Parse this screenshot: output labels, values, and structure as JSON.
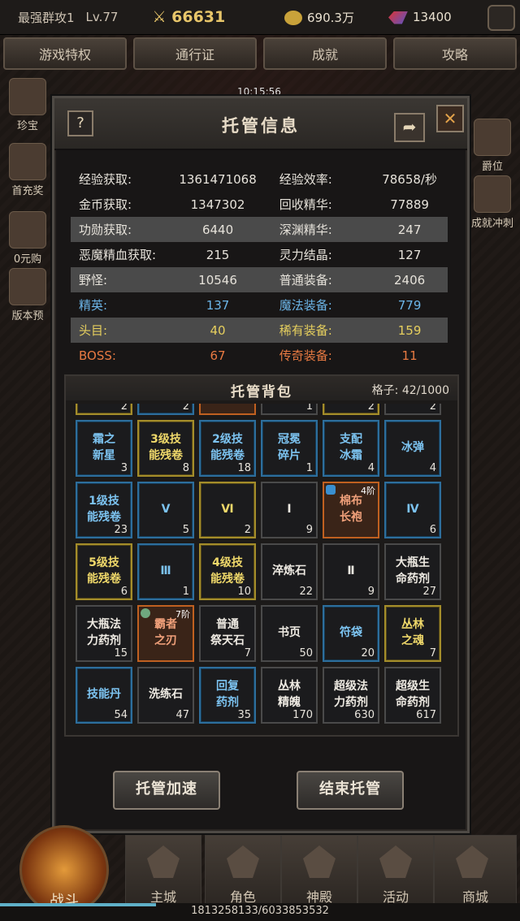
{
  "topbar": {
    "player_name": "最强群攻1",
    "level": "Lv.77",
    "combat_power": "66631",
    "gold": "690.3万",
    "gems": "13400"
  },
  "nav": [
    "游戏特权",
    "通行证",
    "成就",
    "攻略"
  ],
  "clock": "10:15:56",
  "dialog": {
    "title": "托管信息",
    "help_label": "?",
    "close_label": "✕",
    "share_label": "➦",
    "stats": [
      {
        "k1": "经验获取:",
        "v1": "1361471068",
        "k2": "经验效率:",
        "v2": "78658/秒",
        "color": "w",
        "hl": false
      },
      {
        "k1": "金币获取:",
        "v1": "1347302",
        "k2": "回收精华:",
        "v2": "77889",
        "color": "w",
        "hl": false
      },
      {
        "k1": "功勋获取:",
        "v1": "6440",
        "k2": "深渊精华:",
        "v2": "247",
        "color": "w",
        "hl": true
      },
      {
        "k1": "恶魔精血获取:",
        "v1": "215",
        "k2": "灵力结晶:",
        "v2": "127",
        "color": "w",
        "hl": false
      },
      {
        "k1": "野怪:",
        "v1": "10546",
        "k2": "普通装备:",
        "v2": "2406",
        "color": "w",
        "hl": true
      },
      {
        "k1": "精英:",
        "v1": "137",
        "k2": "魔法装备:",
        "v2": "779",
        "color": "b",
        "hl": false
      },
      {
        "k1": "头目:",
        "v1": "40",
        "k2": "稀有装备:",
        "v2": "159",
        "color": "y",
        "hl": true
      },
      {
        "k1": "BOSS:",
        "v1": "67",
        "k2": "传奇装备:",
        "v2": "11",
        "color": "o",
        "hl": false
      }
    ],
    "bag": {
      "title": "托管背包",
      "capacity": "格子: 42/1000",
      "partial_row": [
        {
          "name": "",
          "count": "2",
          "q": "yellow"
        },
        {
          "name": "",
          "count": "2",
          "q": "blue"
        },
        {
          "name": "",
          "count": "",
          "q": "orange"
        },
        {
          "name": "",
          "count": "1",
          "q": "white"
        },
        {
          "name": "",
          "count": "2",
          "q": "yellow"
        },
        {
          "name": "",
          "count": "2",
          "q": "white"
        }
      ],
      "items": [
        {
          "name": "霜之\n新星",
          "count": "3",
          "q": "blue",
          "nc": "b"
        },
        {
          "name": "3级技\n能残卷",
          "count": "8",
          "q": "yellow",
          "nc": "y"
        },
        {
          "name": "2级技\n能残卷",
          "count": "18",
          "q": "blue",
          "nc": "b"
        },
        {
          "name": "冠冕\n碎片",
          "count": "1",
          "q": "blue",
          "nc": "b"
        },
        {
          "name": "支配\n冰霜",
          "count": "4",
          "q": "blue",
          "nc": "b"
        },
        {
          "name": "冰弹",
          "count": "4",
          "q": "blue",
          "nc": "b"
        },
        {
          "name": "1级技\n能残卷",
          "count": "23",
          "q": "blue",
          "nc": "b"
        },
        {
          "name": "Ⅴ",
          "count": "5",
          "q": "blue",
          "nc": "b"
        },
        {
          "name": "Ⅵ",
          "count": "2",
          "q": "yellow",
          "nc": "y"
        },
        {
          "name": "Ⅰ",
          "count": "9",
          "q": "white",
          "nc": "w"
        },
        {
          "name": "棉布\n长袍",
          "count": "",
          "q": "orange",
          "nc": "o",
          "tier": "4阶",
          "tag": "b"
        },
        {
          "name": "Ⅳ",
          "count": "6",
          "q": "blue",
          "nc": "b"
        },
        {
          "name": "5级技\n能残卷",
          "count": "6",
          "q": "yellow",
          "nc": "y"
        },
        {
          "name": "Ⅲ",
          "count": "1",
          "q": "blue",
          "nc": "b"
        },
        {
          "name": "4级技\n能残卷",
          "count": "10",
          "q": "yellow",
          "nc": "y"
        },
        {
          "name": "淬炼石",
          "count": "22",
          "q": "white",
          "nc": "w"
        },
        {
          "name": "Ⅱ",
          "count": "9",
          "q": "white",
          "nc": "w"
        },
        {
          "name": "大瓶生\n命药剂",
          "count": "27",
          "q": "white",
          "nc": "w"
        },
        {
          "name": "大瓶法\n力药剂",
          "count": "15",
          "q": "white",
          "nc": "w"
        },
        {
          "name": "霸者\n之刃",
          "count": "",
          "q": "orange",
          "nc": "o",
          "tier": "7阶",
          "tag": "g"
        },
        {
          "name": "普通\n祭天石",
          "count": "7",
          "q": "white",
          "nc": "w"
        },
        {
          "name": "书页",
          "count": "50",
          "q": "white",
          "nc": "w"
        },
        {
          "name": "符袋",
          "count": "20",
          "q": "blue",
          "nc": "b"
        },
        {
          "name": "丛林\n之魂",
          "count": "7",
          "q": "yellow",
          "nc": "y"
        },
        {
          "name": "技能丹",
          "count": "54",
          "q": "blue",
          "nc": "b"
        },
        {
          "name": "洗练石",
          "count": "47",
          "q": "white",
          "nc": "w"
        },
        {
          "name": "回复\n药剂",
          "count": "35",
          "q": "blue",
          "nc": "b"
        },
        {
          "name": "丛林\n精魄",
          "count": "170",
          "q": "white",
          "nc": "w"
        },
        {
          "name": "超级法\n力药剂",
          "count": "630",
          "q": "white",
          "nc": "w"
        },
        {
          "name": "超级生\n命药剂",
          "count": "617",
          "q": "white",
          "nc": "w"
        }
      ]
    },
    "buttons": {
      "speedup": "托管加速",
      "end": "结束托管"
    }
  },
  "side_left": [
    "珍宝",
    "首充奖",
    "0元购",
    "版本预"
  ],
  "side_right": [
    "爵位",
    "成就冲刺"
  ],
  "bottom_tabs": [
    "战斗",
    "主城",
    "角色",
    "神殿",
    "活动",
    "商城"
  ],
  "exp_text": "1813258133/6033853532",
  "exp_progress": 0.3
}
